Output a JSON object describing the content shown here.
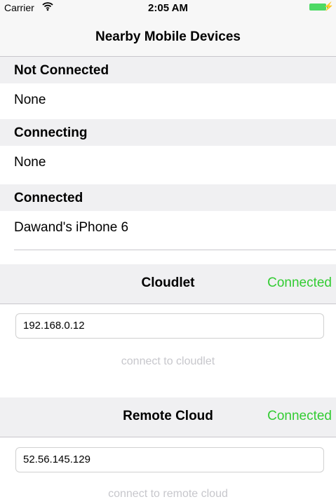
{
  "status_bar": {
    "carrier": "Carrier",
    "time": "2:05 AM"
  },
  "navbar": {
    "title": "Nearby Mobile Devices"
  },
  "sections": {
    "not_connected": {
      "header": "Not Connected",
      "value": "None"
    },
    "connecting": {
      "header": "Connecting",
      "value": "None"
    },
    "connected": {
      "header": "Connected",
      "value": "Dawand's iPhone 6"
    }
  },
  "cloudlet": {
    "title": "Cloudlet",
    "status": "Connected",
    "ip_value": "192.168.0.12",
    "connect_label": "connect to cloudlet"
  },
  "remote_cloud": {
    "title": "Remote Cloud",
    "status": "Connected",
    "ip_value": "52.56.145.129",
    "connect_label": "connect to remote cloud"
  },
  "colors": {
    "status_green": "#33cc33",
    "battery_green": "#4cd964",
    "link_gray": "#c7c7cc"
  }
}
